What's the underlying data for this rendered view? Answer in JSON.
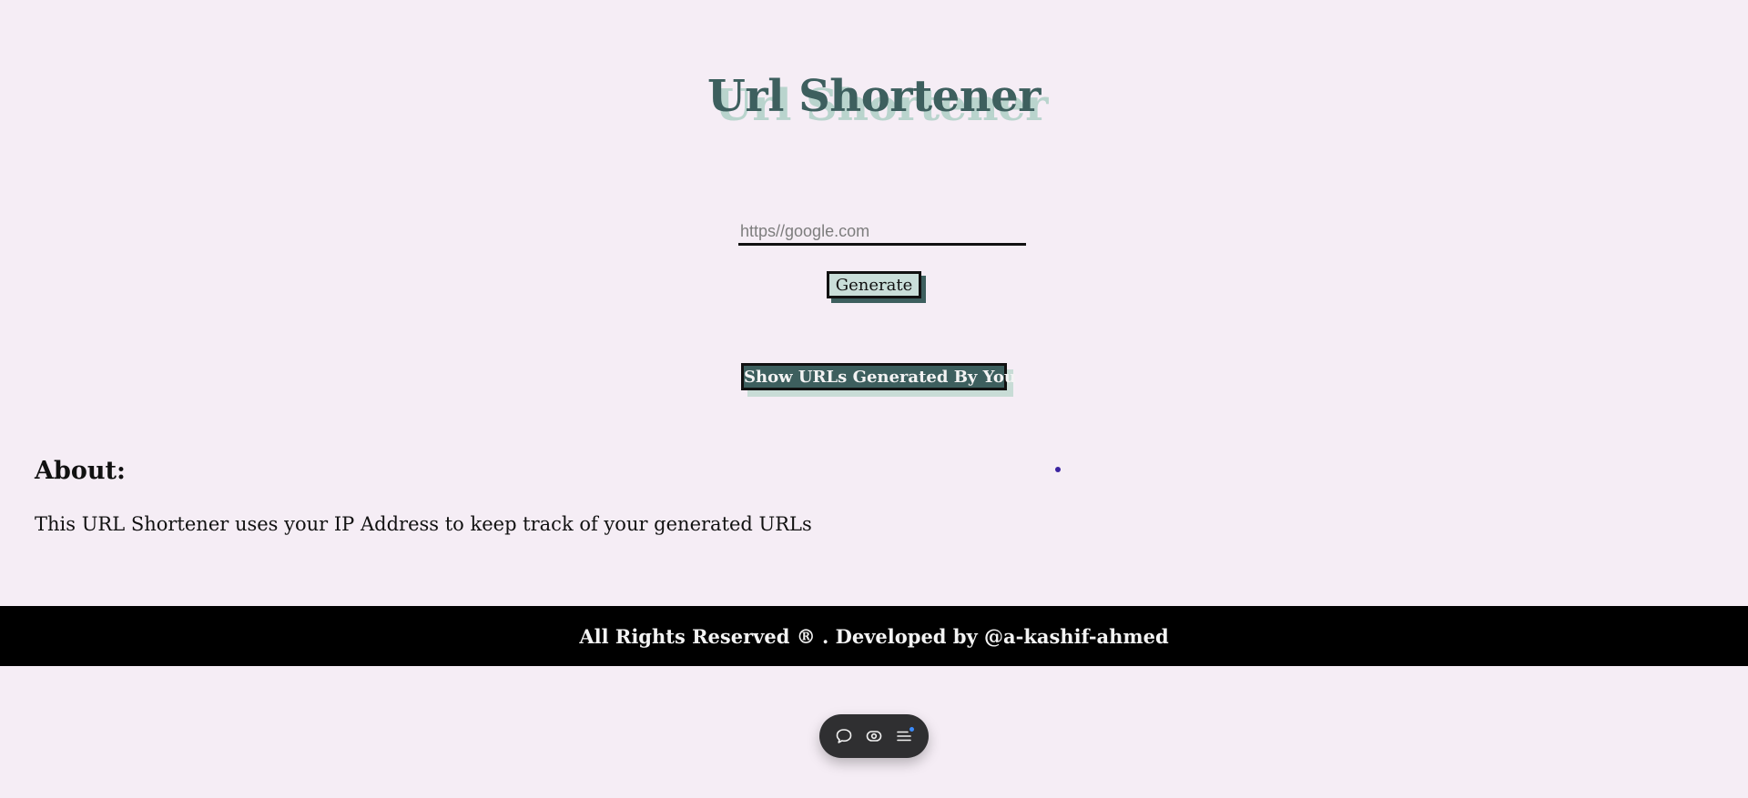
{
  "header": {
    "title": "Url Shortener"
  },
  "form": {
    "url_placeholder": "https//google.com",
    "url_value": "",
    "generate_label": "Generate",
    "show_urls_label": "Show URLs Generated By You"
  },
  "about": {
    "heading": "About:",
    "text": "This URL Shortener uses your IP Address to keep track of your generated URLs"
  },
  "footer": {
    "text": "All Rights Reserved ® . Developed by @a-kashif-ahmed"
  },
  "toolbar": {
    "icons": [
      "chat-bubble-icon",
      "eye-icon",
      "menu-list-icon"
    ]
  },
  "colors": {
    "background": "#f5edf5",
    "title": "#3d5f5e",
    "title_shadow": "#b9d4cd",
    "generate_bg": "#c9ded9",
    "show_bg": "#3d5f5e",
    "footer_bg": "#000000",
    "toolbar_bg": "#2f2f31",
    "notify": "#3b8cff"
  }
}
